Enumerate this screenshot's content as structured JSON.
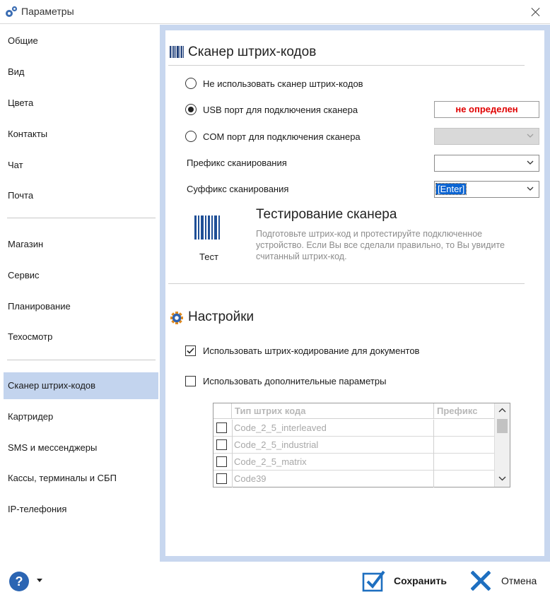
{
  "window": {
    "title": "Параметры"
  },
  "sidebar": {
    "items": [
      {
        "label": "Общие"
      },
      {
        "label": "Вид"
      },
      {
        "label": "Цвета"
      },
      {
        "label": "Контакты"
      },
      {
        "label": "Чат"
      },
      {
        "label": "Почта"
      },
      {
        "label": "Магазин"
      },
      {
        "label": "Сервис"
      },
      {
        "label": "Планирование"
      },
      {
        "label": "Техосмотр"
      },
      {
        "label": "Сканер штрих-кодов",
        "active": true
      },
      {
        "label": "Картридер"
      },
      {
        "label": "SMS и мессенджеры"
      },
      {
        "label": "Кассы, терминалы и СБП"
      },
      {
        "label": "IP-телефония"
      }
    ]
  },
  "scanner": {
    "title": "Сканер штрих-кодов",
    "options": {
      "none": "Не использовать сканер штрих-кодов",
      "usb": "USB порт для подключения сканера",
      "com": "COM порт для подключения сканера"
    },
    "selected": "usb",
    "usb_status": "не определен",
    "com_port_value": "",
    "prefix_label": "Префикс сканирования",
    "prefix_value": "",
    "suffix_label": "Суффикс сканирования",
    "suffix_value": "[Enter]"
  },
  "test": {
    "title": "Тестирование сканера",
    "description": "Подготовьте штрих-код и протестируйте подключенное устройство. Если Вы все сделали правильно, то Вы увидите считанный штрих-код.",
    "button_label": "Тест"
  },
  "settings": {
    "title": "Настройки",
    "use_barcoding_label": "Использовать штрих-кодирование для документов",
    "use_barcoding_checked": true,
    "use_extra_label": "Использовать дополнительные параметры",
    "use_extra_checked": false
  },
  "grid": {
    "columns": [
      "Тип штрих кода",
      "Префикс"
    ],
    "rows": [
      {
        "name": "Code_2_5_interleaved",
        "prefix": ""
      },
      {
        "name": "Code_2_5_industrial",
        "prefix": ""
      },
      {
        "name": "Code_2_5_matrix",
        "prefix": ""
      },
      {
        "name": "Code39",
        "prefix": ""
      }
    ]
  },
  "footer": {
    "save_label": "Сохранить",
    "cancel_label": "Отмена"
  },
  "colors": {
    "accent": "#1e6fc0",
    "active_nav": "#c3d4ee",
    "frame": "#c8d7ef",
    "status_error": "#e00000"
  },
  "icons": {
    "title": "gears-icon",
    "scanner_section": "barcode-icon",
    "settings_section": "gear-icon",
    "test_button": "barcode-icon",
    "help": "help-icon",
    "save": "checkmark-icon",
    "cancel": "close-icon"
  }
}
